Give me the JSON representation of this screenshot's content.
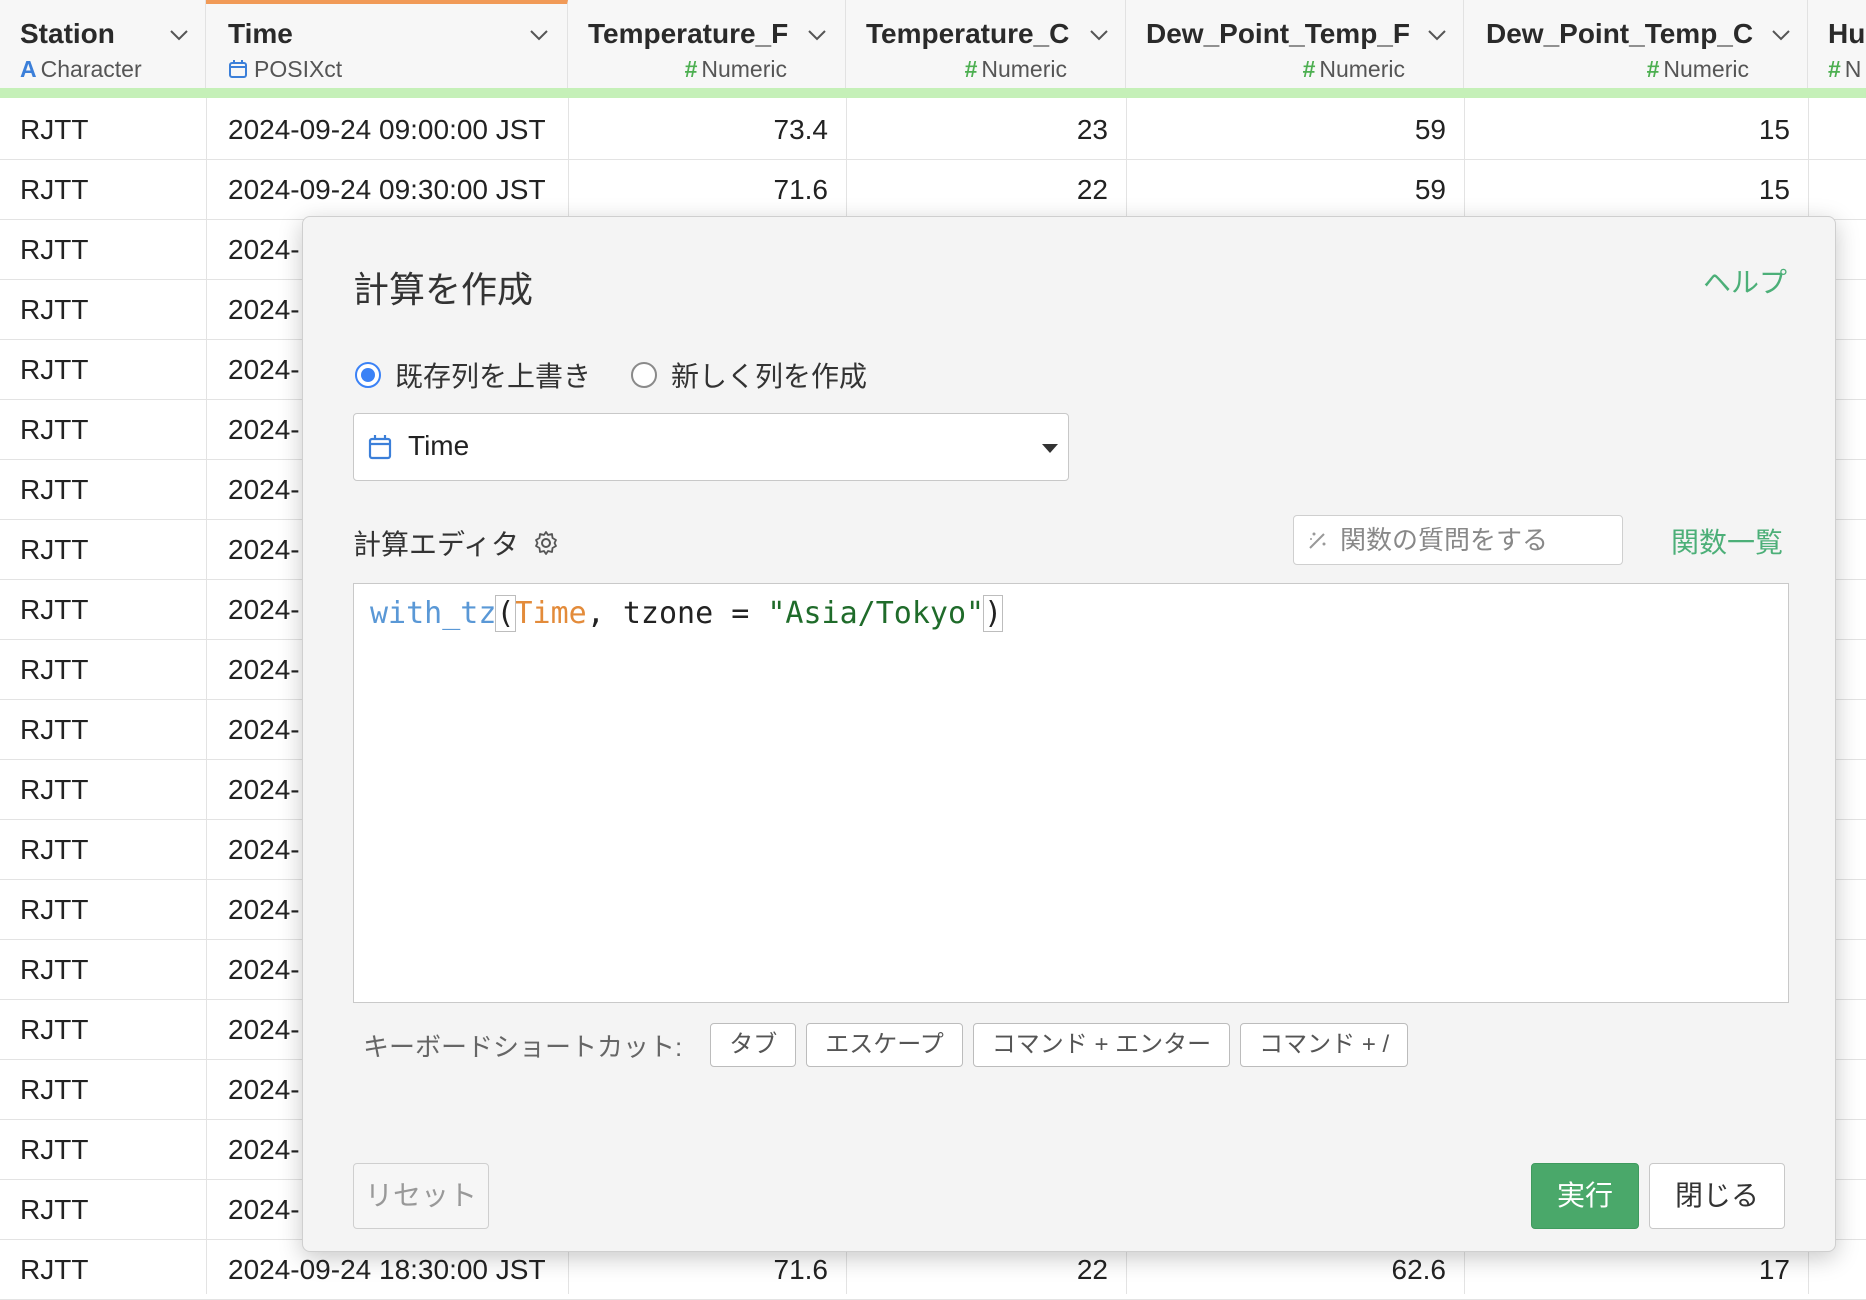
{
  "columns": [
    {
      "name": "Station",
      "type": "Character",
      "type_glyph": "A"
    },
    {
      "name": "Time",
      "type": "POSIXct",
      "type_glyph": ""
    },
    {
      "name": "Temperature_F",
      "type": "Numeric",
      "type_glyph": "#"
    },
    {
      "name": "Temperature_C",
      "type": "Numeric",
      "type_glyph": "#"
    },
    {
      "name": "Dew_Point_Temp_F",
      "type": "Numeric",
      "type_glyph": "#"
    },
    {
      "name": "Dew_Point_Temp_C",
      "type": "Numeric",
      "type_glyph": "#"
    },
    {
      "name": "Hu",
      "type": "N",
      "type_glyph": "#"
    }
  ],
  "rows": [
    {
      "station": "RJTT",
      "time": "2024-09-24 09:00:00 JST",
      "temp_f": "73.4",
      "temp_c": "23",
      "dew_f": "59",
      "dew_c": "15"
    },
    {
      "station": "RJTT",
      "time": "2024-09-24 09:30:00 JST",
      "temp_f": "71.6",
      "temp_c": "22",
      "dew_f": "59",
      "dew_c": "15"
    },
    {
      "station": "RJTT",
      "time": "2024-"
    },
    {
      "station": "RJTT",
      "time": "2024-"
    },
    {
      "station": "RJTT",
      "time": "2024-"
    },
    {
      "station": "RJTT",
      "time": "2024-"
    },
    {
      "station": "RJTT",
      "time": "2024-"
    },
    {
      "station": "RJTT",
      "time": "2024-"
    },
    {
      "station": "RJTT",
      "time": "2024-"
    },
    {
      "station": "RJTT",
      "time": "2024-"
    },
    {
      "station": "RJTT",
      "time": "2024-"
    },
    {
      "station": "RJTT",
      "time": "2024-"
    },
    {
      "station": "RJTT",
      "time": "2024-"
    },
    {
      "station": "RJTT",
      "time": "2024-"
    },
    {
      "station": "RJTT",
      "time": "2024-"
    },
    {
      "station": "RJTT",
      "time": "2024-"
    },
    {
      "station": "RJTT",
      "time": "2024-"
    },
    {
      "station": "RJTT",
      "time": "2024-"
    },
    {
      "station": "RJTT",
      "time": "2024-"
    },
    {
      "station": "RJTT",
      "time": "2024-09-24 18:30:00 JST",
      "temp_f": "71.6",
      "temp_c": "22",
      "dew_f": "62.6",
      "dew_c": "17"
    }
  ],
  "dialog": {
    "title": "計算を作成",
    "help": "ヘルプ",
    "radio_overwrite": "既存列を上書き",
    "radio_new": "新しく列を作成",
    "selected_column": "Time",
    "editor_label": "計算エディタ",
    "ask_placeholder": "関数の質問をする",
    "function_list": "関数一覧",
    "code": {
      "fn": "with_tz",
      "open": "(",
      "col": "Time",
      "mid": ", tzone = ",
      "str": "\"Asia/Tokyo\"",
      "close": ")"
    },
    "shortcuts_label": "キーボードショートカット:",
    "shortcuts": [
      "タブ",
      "エスケープ",
      "コマンド + エンター",
      "コマンド + /"
    ],
    "reset": "リセット",
    "run": "実行",
    "close": "閉じる"
  },
  "colors": {
    "accent_green": "#4aa86a",
    "selected_column_border": "#f19a57",
    "header_bar": "#c5f0b8",
    "radio_blue": "#3b82f6"
  }
}
